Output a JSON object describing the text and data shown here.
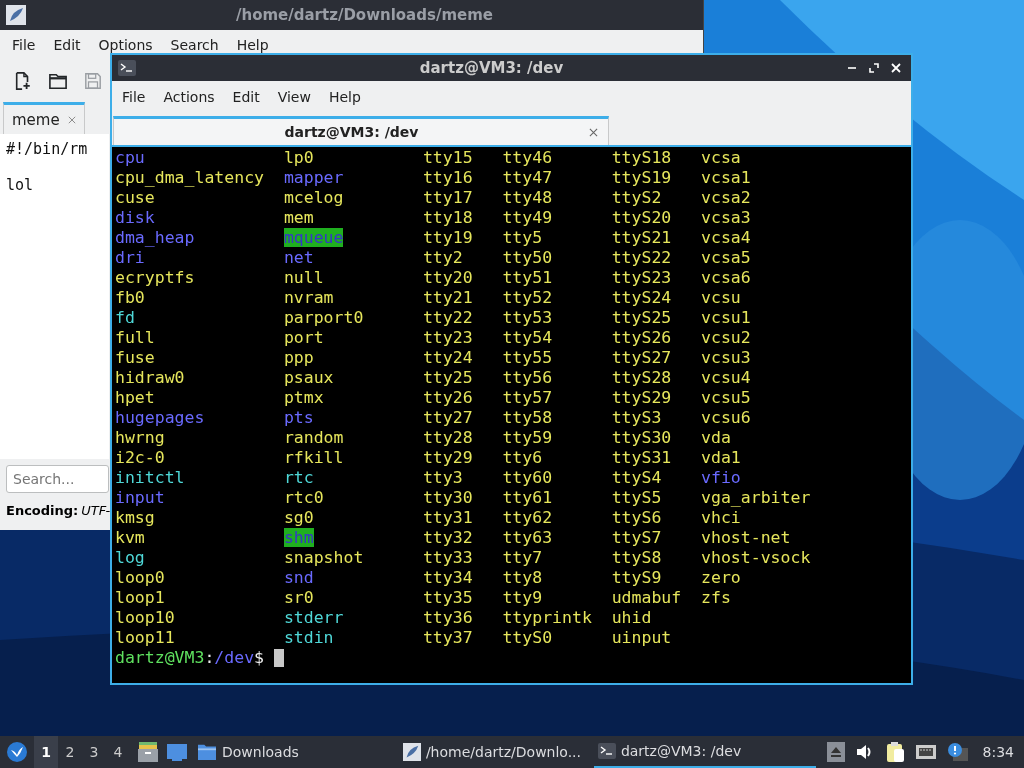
{
  "editor_window": {
    "title": "/home/dartz/Downloads/meme",
    "menu": [
      "File",
      "Edit",
      "Options",
      "Search",
      "Help"
    ],
    "toolbar": [
      {
        "kind": "new",
        "disabled": false
      },
      {
        "kind": "open",
        "disabled": false
      },
      {
        "kind": "save",
        "disabled": true
      }
    ],
    "tabs": [
      {
        "label": "meme",
        "selected": true
      }
    ],
    "text": "#!/bin/rm\n\nlol",
    "search": {
      "placeholder": "Search..."
    },
    "encoding": {
      "label": "Encoding:",
      "value": "UTF-"
    }
  },
  "terminal_window": {
    "title": "dartz@VM3: /dev",
    "menu": [
      "File",
      "Actions",
      "Edit",
      "View",
      "Help"
    ],
    "tabs": [
      {
        "label": "dartz@VM3: /dev",
        "selected": true
      }
    ],
    "listing": [
      [
        {
          "name": "cpu",
          "kind": "dir"
        },
        {
          "name": "cpu_dma_latency",
          "kind": "device"
        },
        {
          "name": "cuse",
          "kind": "device"
        },
        {
          "name": "disk",
          "kind": "dir"
        },
        {
          "name": "dma_heap",
          "kind": "dir"
        },
        {
          "name": "dri",
          "kind": "dir"
        },
        {
          "name": "ecryptfs",
          "kind": "device"
        },
        {
          "name": "fb0",
          "kind": "device"
        },
        {
          "name": "fd",
          "kind": "link"
        },
        {
          "name": "full",
          "kind": "device"
        },
        {
          "name": "fuse",
          "kind": "device"
        },
        {
          "name": "hidraw0",
          "kind": "device"
        },
        {
          "name": "hpet",
          "kind": "device"
        },
        {
          "name": "hugepages",
          "kind": "dir"
        },
        {
          "name": "hwrng",
          "kind": "device"
        },
        {
          "name": "i2c-0",
          "kind": "device"
        },
        {
          "name": "initctl",
          "kind": "link"
        },
        {
          "name": "input",
          "kind": "dir"
        },
        {
          "name": "kmsg",
          "kind": "device"
        },
        {
          "name": "kvm",
          "kind": "device"
        },
        {
          "name": "log",
          "kind": "link"
        },
        {
          "name": "loop0",
          "kind": "device"
        },
        {
          "name": "loop1",
          "kind": "device"
        },
        {
          "name": "loop10",
          "kind": "device"
        },
        {
          "name": "loop11",
          "kind": "device"
        }
      ],
      [
        {
          "name": "lp0",
          "kind": "device"
        },
        {
          "name": "mapper",
          "kind": "dir"
        },
        {
          "name": "mcelog",
          "kind": "device"
        },
        {
          "name": "mem",
          "kind": "device"
        },
        {
          "name": "mqueue",
          "kind": "sticky"
        },
        {
          "name": "net",
          "kind": "dir"
        },
        {
          "name": "null",
          "kind": "device"
        },
        {
          "name": "nvram",
          "kind": "device"
        },
        {
          "name": "parport0",
          "kind": "device"
        },
        {
          "name": "port",
          "kind": "device"
        },
        {
          "name": "ppp",
          "kind": "device"
        },
        {
          "name": "psaux",
          "kind": "device"
        },
        {
          "name": "ptmx",
          "kind": "device"
        },
        {
          "name": "pts",
          "kind": "dir"
        },
        {
          "name": "random",
          "kind": "device"
        },
        {
          "name": "rfkill",
          "kind": "device"
        },
        {
          "name": "rtc",
          "kind": "link"
        },
        {
          "name": "rtc0",
          "kind": "device"
        },
        {
          "name": "sg0",
          "kind": "device"
        },
        {
          "name": "shm",
          "kind": "sticky"
        },
        {
          "name": "snapshot",
          "kind": "device"
        },
        {
          "name": "snd",
          "kind": "dir"
        },
        {
          "name": "sr0",
          "kind": "device"
        },
        {
          "name": "stderr",
          "kind": "link"
        },
        {
          "name": "stdin",
          "kind": "link"
        }
      ],
      [
        {
          "name": "tty15",
          "kind": "device"
        },
        {
          "name": "tty16",
          "kind": "device"
        },
        {
          "name": "tty17",
          "kind": "device"
        },
        {
          "name": "tty18",
          "kind": "device"
        },
        {
          "name": "tty19",
          "kind": "device"
        },
        {
          "name": "tty2",
          "kind": "device"
        },
        {
          "name": "tty20",
          "kind": "device"
        },
        {
          "name": "tty21",
          "kind": "device"
        },
        {
          "name": "tty22",
          "kind": "device"
        },
        {
          "name": "tty23",
          "kind": "device"
        },
        {
          "name": "tty24",
          "kind": "device"
        },
        {
          "name": "tty25",
          "kind": "device"
        },
        {
          "name": "tty26",
          "kind": "device"
        },
        {
          "name": "tty27",
          "kind": "device"
        },
        {
          "name": "tty28",
          "kind": "device"
        },
        {
          "name": "tty29",
          "kind": "device"
        },
        {
          "name": "tty3",
          "kind": "device"
        },
        {
          "name": "tty30",
          "kind": "device"
        },
        {
          "name": "tty31",
          "kind": "device"
        },
        {
          "name": "tty32",
          "kind": "device"
        },
        {
          "name": "tty33",
          "kind": "device"
        },
        {
          "name": "tty34",
          "kind": "device"
        },
        {
          "name": "tty35",
          "kind": "device"
        },
        {
          "name": "tty36",
          "kind": "device"
        },
        {
          "name": "tty37",
          "kind": "device"
        }
      ],
      [
        {
          "name": "tty46",
          "kind": "device"
        },
        {
          "name": "tty47",
          "kind": "device"
        },
        {
          "name": "tty48",
          "kind": "device"
        },
        {
          "name": "tty49",
          "kind": "device"
        },
        {
          "name": "tty5",
          "kind": "device"
        },
        {
          "name": "tty50",
          "kind": "device"
        },
        {
          "name": "tty51",
          "kind": "device"
        },
        {
          "name": "tty52",
          "kind": "device"
        },
        {
          "name": "tty53",
          "kind": "device"
        },
        {
          "name": "tty54",
          "kind": "device"
        },
        {
          "name": "tty55",
          "kind": "device"
        },
        {
          "name": "tty56",
          "kind": "device"
        },
        {
          "name": "tty57",
          "kind": "device"
        },
        {
          "name": "tty58",
          "kind": "device"
        },
        {
          "name": "tty59",
          "kind": "device"
        },
        {
          "name": "tty6",
          "kind": "device"
        },
        {
          "name": "tty60",
          "kind": "device"
        },
        {
          "name": "tty61",
          "kind": "device"
        },
        {
          "name": "tty62",
          "kind": "device"
        },
        {
          "name": "tty63",
          "kind": "device"
        },
        {
          "name": "tty7",
          "kind": "device"
        },
        {
          "name": "tty8",
          "kind": "device"
        },
        {
          "name": "tty9",
          "kind": "device"
        },
        {
          "name": "ttyprintk",
          "kind": "device"
        },
        {
          "name": "ttyS0",
          "kind": "device"
        }
      ],
      [
        {
          "name": "ttyS18",
          "kind": "device"
        },
        {
          "name": "ttyS19",
          "kind": "device"
        },
        {
          "name": "ttyS2",
          "kind": "device"
        },
        {
          "name": "ttyS20",
          "kind": "device"
        },
        {
          "name": "ttyS21",
          "kind": "device"
        },
        {
          "name": "ttyS22",
          "kind": "device"
        },
        {
          "name": "ttyS23",
          "kind": "device"
        },
        {
          "name": "ttyS24",
          "kind": "device"
        },
        {
          "name": "ttyS25",
          "kind": "device"
        },
        {
          "name": "ttyS26",
          "kind": "device"
        },
        {
          "name": "ttyS27",
          "kind": "device"
        },
        {
          "name": "ttyS28",
          "kind": "device"
        },
        {
          "name": "ttyS29",
          "kind": "device"
        },
        {
          "name": "ttyS3",
          "kind": "device"
        },
        {
          "name": "ttyS30",
          "kind": "device"
        },
        {
          "name": "ttyS31",
          "kind": "device"
        },
        {
          "name": "ttyS4",
          "kind": "device"
        },
        {
          "name": "ttyS5",
          "kind": "device"
        },
        {
          "name": "ttyS6",
          "kind": "device"
        },
        {
          "name": "ttyS7",
          "kind": "device"
        },
        {
          "name": "ttyS8",
          "kind": "device"
        },
        {
          "name": "ttyS9",
          "kind": "device"
        },
        {
          "name": "udmabuf",
          "kind": "device"
        },
        {
          "name": "uhid",
          "kind": "device"
        },
        {
          "name": "uinput",
          "kind": "device"
        }
      ],
      [
        {
          "name": "vcsa",
          "kind": "device"
        },
        {
          "name": "vcsa1",
          "kind": "device"
        },
        {
          "name": "vcsa2",
          "kind": "device"
        },
        {
          "name": "vcsa3",
          "kind": "device"
        },
        {
          "name": "vcsa4",
          "kind": "device"
        },
        {
          "name": "vcsa5",
          "kind": "device"
        },
        {
          "name": "vcsa6",
          "kind": "device"
        },
        {
          "name": "vcsu",
          "kind": "device"
        },
        {
          "name": "vcsu1",
          "kind": "device"
        },
        {
          "name": "vcsu2",
          "kind": "device"
        },
        {
          "name": "vcsu3",
          "kind": "device"
        },
        {
          "name": "vcsu4",
          "kind": "device"
        },
        {
          "name": "vcsu5",
          "kind": "device"
        },
        {
          "name": "vcsu6",
          "kind": "device"
        },
        {
          "name": "vda",
          "kind": "device"
        },
        {
          "name": "vda1",
          "kind": "device"
        },
        {
          "name": "vfio",
          "kind": "dir"
        },
        {
          "name": "vga_arbiter",
          "kind": "device"
        },
        {
          "name": "vhci",
          "kind": "device"
        },
        {
          "name": "vhost-net",
          "kind": "device"
        },
        {
          "name": "vhost-vsock",
          "kind": "device"
        },
        {
          "name": "zero",
          "kind": "device"
        },
        {
          "name": "zfs",
          "kind": "device"
        }
      ]
    ],
    "prompt": {
      "user_host": "dartz@VM3",
      "separator": ":",
      "path": "/dev",
      "symbol": "$"
    }
  },
  "taskbar": {
    "desktops": [
      {
        "label": "1",
        "selected": true
      },
      {
        "label": "2",
        "selected": false
      },
      {
        "label": "3",
        "selected": false
      },
      {
        "label": "4",
        "selected": false
      }
    ],
    "launchers": [
      {
        "kind": "files"
      },
      {
        "kind": "desktop"
      }
    ],
    "tasks": [
      {
        "kind": "folder",
        "label": "Downloads",
        "selected": false
      },
      {
        "kind": "editor",
        "label": "/home/dartz/Downlo...",
        "selected": false
      },
      {
        "kind": "terminal",
        "label": "dartz@VM3: /dev",
        "selected": true
      }
    ],
    "tray": [
      {
        "kind": "eject"
      },
      {
        "kind": "volume"
      },
      {
        "kind": "clipboard"
      },
      {
        "kind": "network"
      },
      {
        "kind": "notification"
      }
    ],
    "clock": "8:34"
  }
}
